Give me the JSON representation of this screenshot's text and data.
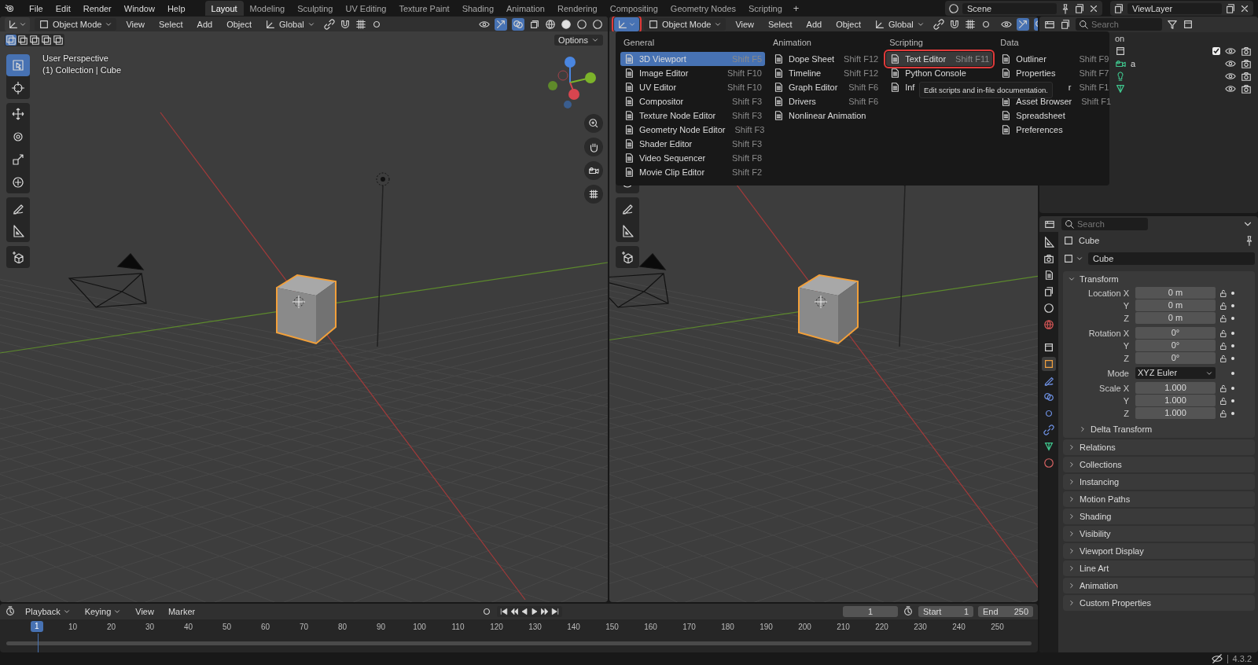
{
  "topbar": {
    "menus": [
      "File",
      "Edit",
      "Render",
      "Window",
      "Help"
    ],
    "workspaces": [
      {
        "label": "Layout",
        "selected": true
      },
      {
        "label": "Modeling",
        "selected": false
      },
      {
        "label": "Sculpting",
        "selected": false
      },
      {
        "label": "UV Editing",
        "selected": false
      },
      {
        "label": "Texture Paint",
        "selected": false
      },
      {
        "label": "Shading",
        "selected": false
      },
      {
        "label": "Animation",
        "selected": false
      },
      {
        "label": "Rendering",
        "selected": false
      },
      {
        "label": "Compositing",
        "selected": false
      },
      {
        "label": "Geometry Nodes",
        "selected": false
      },
      {
        "label": "Scripting",
        "selected": false
      }
    ],
    "add_label": "+",
    "scene": "Scene",
    "view_layer": "ViewLayer"
  },
  "viewports": [
    {
      "editor_highlighted": false,
      "mode": "Object Mode",
      "menus": [
        "View",
        "Select",
        "Add",
        "Object"
      ],
      "orientation": "Global",
      "options": "Options",
      "overlay": [
        "User Perspective",
        "(1) Collection | Cube"
      ]
    },
    {
      "editor_highlighted": true,
      "mode": "Object Mode",
      "menus": [
        "View",
        "Select",
        "Add",
        "Object"
      ],
      "orientation": "Global"
    }
  ],
  "editor_menu": {
    "columns": [
      {
        "heading": "General",
        "items": [
          {
            "label": "3D Viewport",
            "shortcut": "Shift F5",
            "selected": true,
            "highlighted": false
          },
          {
            "label": "Image Editor",
            "shortcut": "Shift F10",
            "selected": false,
            "highlighted": false
          },
          {
            "label": "UV Editor",
            "shortcut": "Shift F10",
            "selected": false,
            "highlighted": false
          },
          {
            "label": "Compositor",
            "shortcut": "Shift F3",
            "selected": false,
            "highlighted": false
          },
          {
            "label": "Texture Node Editor",
            "shortcut": "Shift F3",
            "selected": false,
            "highlighted": false
          },
          {
            "label": "Geometry Node Editor",
            "shortcut": "Shift F3",
            "selected": false,
            "highlighted": false
          },
          {
            "label": "Shader Editor",
            "shortcut": "Shift F3",
            "selected": false,
            "highlighted": false
          },
          {
            "label": "Video Sequencer",
            "shortcut": "Shift F8",
            "selected": false,
            "highlighted": false
          },
          {
            "label": "Movie Clip Editor",
            "shortcut": "Shift F2",
            "selected": false,
            "highlighted": false
          }
        ]
      },
      {
        "heading": "Animation",
        "items": [
          {
            "label": "Dope Sheet",
            "shortcut": "Shift F12",
            "selected": false,
            "highlighted": false
          },
          {
            "label": "Timeline",
            "shortcut": "Shift F12",
            "selected": false,
            "highlighted": false
          },
          {
            "label": "Graph Editor",
            "shortcut": "Shift F6",
            "selected": false,
            "highlighted": false
          },
          {
            "label": "Drivers",
            "shortcut": "Shift F6",
            "selected": false,
            "highlighted": false
          },
          {
            "label": "Nonlinear Animation",
            "selected": false,
            "highlighted": false
          }
        ]
      },
      {
        "heading": "Scripting",
        "items": [
          {
            "label": "Text Editor",
            "shortcut": "Shift F11",
            "selected": false,
            "highlighted": true
          },
          {
            "label": "Python Console",
            "selected": false,
            "highlighted": false
          },
          {
            "label": "Inf",
            "selected": false,
            "highlighted": false
          }
        ]
      },
      {
        "heading": "Data",
        "items": [
          {
            "label": "Outliner",
            "shortcut": "Shift F9",
            "selected": false,
            "highlighted": false
          },
          {
            "label": "Properties",
            "shortcut": "Shift F7",
            "selected": false,
            "highlighted": false
          },
          {
            "label": "r",
            "shortcut": "Shift F1",
            "selected": false,
            "highlighted": false,
            "covered": true
          },
          {
            "label": "Asset Browser",
            "shortcut": "Shift F1",
            "selected": false,
            "highlighted": false
          },
          {
            "label": "Spreadsheet",
            "selected": false,
            "highlighted": false
          },
          {
            "label": "Preferences",
            "selected": false,
            "highlighted": false
          }
        ]
      }
    ],
    "tooltip": "Edit scripts and in-file documentation."
  },
  "outliner": {
    "search": {
      "placeholder": "Search"
    },
    "rows": [
      {
        "kind": "header",
        "text": "on"
      },
      {
        "kind": "collection",
        "checked": true
      },
      {
        "kind": "camera",
        "text": "a"
      },
      {
        "kind": "light"
      },
      {
        "kind": "object"
      }
    ]
  },
  "properties": {
    "search": {
      "placeholder": "Search"
    },
    "object_name": "Cube",
    "data_name": "Cube",
    "tabs": [
      {
        "kind": "tool",
        "selected": false
      },
      {
        "kind": "render",
        "selected": false
      },
      {
        "kind": "output",
        "selected": false
      },
      {
        "kind": "view_layer",
        "selected": false
      },
      {
        "kind": "scene",
        "selected": false
      },
      {
        "kind": "world",
        "selected": false
      },
      {
        "kind": "collection",
        "selected": false
      },
      {
        "kind": "object",
        "selected": true
      },
      {
        "kind": "modifier",
        "selected": false
      },
      {
        "kind": "particles",
        "selected": false
      },
      {
        "kind": "physics",
        "selected": false
      },
      {
        "kind": "constraints",
        "selected": false
      },
      {
        "kind": "data",
        "selected": false
      },
      {
        "kind": "material",
        "selected": false
      }
    ],
    "transform": {
      "title": "Transform",
      "expanded": true,
      "groups": [
        {
          "kind": "number",
          "rows": [
            {
              "label": "Location X",
              "value": "0 m"
            },
            {
              "label": "Y",
              "value": "0 m"
            },
            {
              "label": "Z",
              "value": "0 m"
            }
          ]
        },
        {
          "kind": "number",
          "rows": [
            {
              "label": "Rotation X",
              "value": "0°"
            },
            {
              "label": "Y",
              "value": "0°"
            },
            {
              "label": "Z",
              "value": "0°"
            }
          ]
        },
        {
          "kind": "dropdown",
          "rows": [
            {
              "label": "Mode",
              "value": "XYZ Euler"
            }
          ]
        },
        {
          "kind": "number",
          "rows": [
            {
              "label": "Scale X",
              "value": "1.000"
            },
            {
              "label": "Y",
              "value": "1.000"
            },
            {
              "label": "Z",
              "value": "1.000"
            }
          ]
        }
      ],
      "subpanel": {
        "title": "Delta Transform",
        "expanded": false
      }
    },
    "panels": [
      {
        "title": "Relations",
        "expanded": false
      },
      {
        "title": "Collections",
        "expanded": false
      },
      {
        "title": "Instancing",
        "expanded": false
      },
      {
        "title": "Motion Paths",
        "expanded": false
      },
      {
        "title": "Shading",
        "expanded": false
      },
      {
        "title": "Visibility",
        "expanded": false
      },
      {
        "title": "Viewport Display",
        "expanded": false
      },
      {
        "title": "Line Art",
        "expanded": false
      },
      {
        "title": "Animation",
        "expanded": false
      },
      {
        "title": "Custom Properties",
        "expanded": false
      }
    ]
  },
  "timeline": {
    "menus": [
      {
        "label": "Playback",
        "dropdown": true
      },
      {
        "label": "Keying",
        "dropdown": true
      },
      {
        "label": "View",
        "dropdown": false
      },
      {
        "label": "Marker",
        "dropdown": false
      }
    ],
    "current_frame": "1",
    "start_label": "Start",
    "start": "1",
    "end_label": "End",
    "end": "250",
    "playhead": "1",
    "ticks": [
      "10",
      "20",
      "30",
      "40",
      "50",
      "60",
      "70",
      "80",
      "90",
      "100",
      "110",
      "120",
      "130",
      "140",
      "150",
      "160",
      "170",
      "180",
      "190",
      "200",
      "210",
      "220",
      "230",
      "240",
      "250"
    ]
  },
  "status_bar": {
    "version": "4.3.2"
  }
}
